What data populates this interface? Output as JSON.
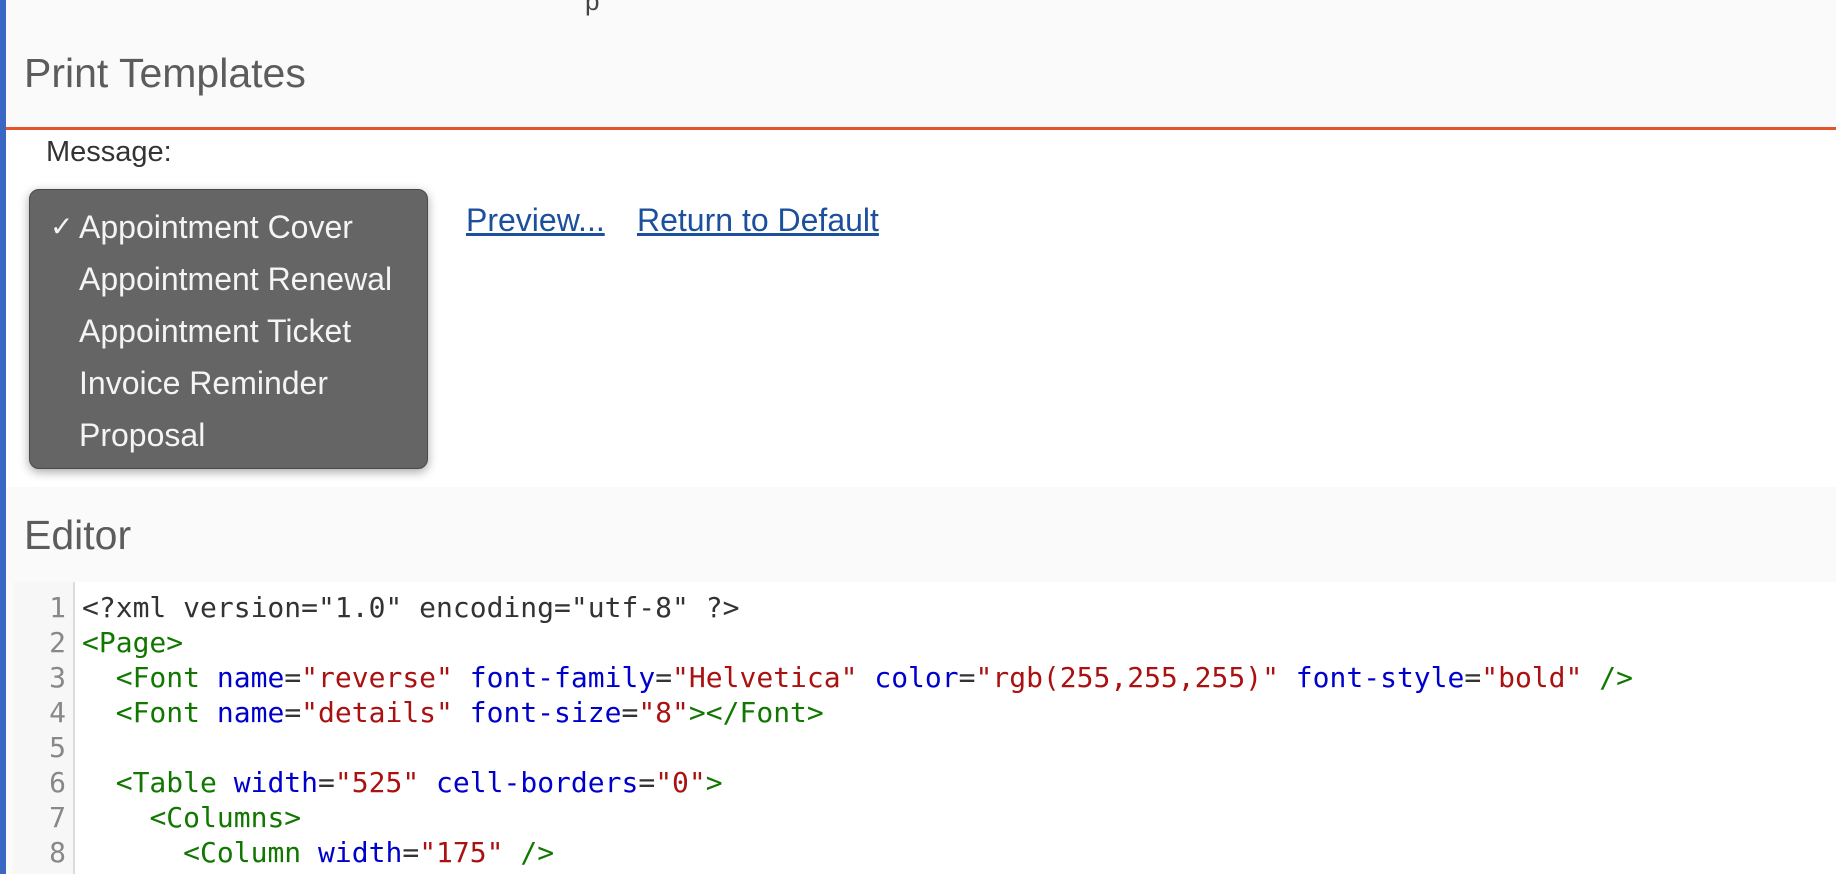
{
  "top_fragment": "p",
  "print_templates": {
    "title": "Print Templates",
    "message_label": "Message:",
    "dropdown": {
      "selected": "Appointment Cover",
      "options": [
        {
          "label": "Appointment Cover",
          "checked": true
        },
        {
          "label": "Appointment Renewal",
          "checked": false
        },
        {
          "label": "Appointment Ticket",
          "checked": false
        },
        {
          "label": "Invoice Reminder",
          "checked": false
        },
        {
          "label": "Proposal",
          "checked": false
        }
      ],
      "check_glyph": "✓"
    },
    "preview_link": "Preview...",
    "return_default_link": "Return to Default"
  },
  "editor": {
    "title": "Editor",
    "lines": [
      {
        "num": "1",
        "tokens": [
          {
            "t": "plain",
            "v": "<?xml version=\"1.0\" encoding=\"utf-8\" ?>"
          }
        ]
      },
      {
        "num": "2",
        "tokens": [
          {
            "t": "tag",
            "v": "<Page>"
          }
        ]
      },
      {
        "num": "3",
        "tokens": [
          {
            "t": "plain",
            "v": "  "
          },
          {
            "t": "tag",
            "v": "<Font"
          },
          {
            "t": "plain",
            "v": " "
          },
          {
            "t": "attr",
            "v": "name"
          },
          {
            "t": "plain",
            "v": "="
          },
          {
            "t": "str",
            "v": "\"reverse\""
          },
          {
            "t": "plain",
            "v": " "
          },
          {
            "t": "attr",
            "v": "font-family"
          },
          {
            "t": "plain",
            "v": "="
          },
          {
            "t": "str",
            "v": "\"Helvetica\""
          },
          {
            "t": "plain",
            "v": " "
          },
          {
            "t": "attr",
            "v": "color"
          },
          {
            "t": "plain",
            "v": "="
          },
          {
            "t": "str",
            "v": "\"rgb(255,255,255)\""
          },
          {
            "t": "plain",
            "v": " "
          },
          {
            "t": "attr",
            "v": "font-style"
          },
          {
            "t": "plain",
            "v": "="
          },
          {
            "t": "str",
            "v": "\"bold\""
          },
          {
            "t": "plain",
            "v": " "
          },
          {
            "t": "tag",
            "v": "/>"
          }
        ]
      },
      {
        "num": "4",
        "tokens": [
          {
            "t": "plain",
            "v": "  "
          },
          {
            "t": "tag",
            "v": "<Font"
          },
          {
            "t": "plain",
            "v": " "
          },
          {
            "t": "attr",
            "v": "name"
          },
          {
            "t": "plain",
            "v": "="
          },
          {
            "t": "str",
            "v": "\"details\""
          },
          {
            "t": "plain",
            "v": " "
          },
          {
            "t": "attr",
            "v": "font-size"
          },
          {
            "t": "plain",
            "v": "="
          },
          {
            "t": "str",
            "v": "\"8\""
          },
          {
            "t": "tag",
            "v": "></Font>"
          }
        ]
      },
      {
        "num": "5",
        "tokens": []
      },
      {
        "num": "6",
        "tokens": [
          {
            "t": "plain",
            "v": "  "
          },
          {
            "t": "tag",
            "v": "<Table"
          },
          {
            "t": "plain",
            "v": " "
          },
          {
            "t": "attr",
            "v": "width"
          },
          {
            "t": "plain",
            "v": "="
          },
          {
            "t": "str",
            "v": "\"525\""
          },
          {
            "t": "plain",
            "v": " "
          },
          {
            "t": "attr",
            "v": "cell-borders"
          },
          {
            "t": "plain",
            "v": "="
          },
          {
            "t": "str",
            "v": "\"0\""
          },
          {
            "t": "tag",
            "v": ">"
          }
        ]
      },
      {
        "num": "7",
        "tokens": [
          {
            "t": "plain",
            "v": "    "
          },
          {
            "t": "tag",
            "v": "<Columns>"
          }
        ]
      },
      {
        "num": "8",
        "tokens": [
          {
            "t": "plain",
            "v": "      "
          },
          {
            "t": "tag",
            "v": "<Column"
          },
          {
            "t": "plain",
            "v": " "
          },
          {
            "t": "attr",
            "v": "width"
          },
          {
            "t": "plain",
            "v": "="
          },
          {
            "t": "str",
            "v": "\"175\""
          },
          {
            "t": "plain",
            "v": " "
          },
          {
            "t": "tag",
            "v": "/>"
          }
        ]
      }
    ]
  },
  "colors": {
    "accent_line": "#e5542b",
    "left_bar": "#3a66c4",
    "link": "#1c4f9c",
    "dropdown_bg": "#656565"
  }
}
